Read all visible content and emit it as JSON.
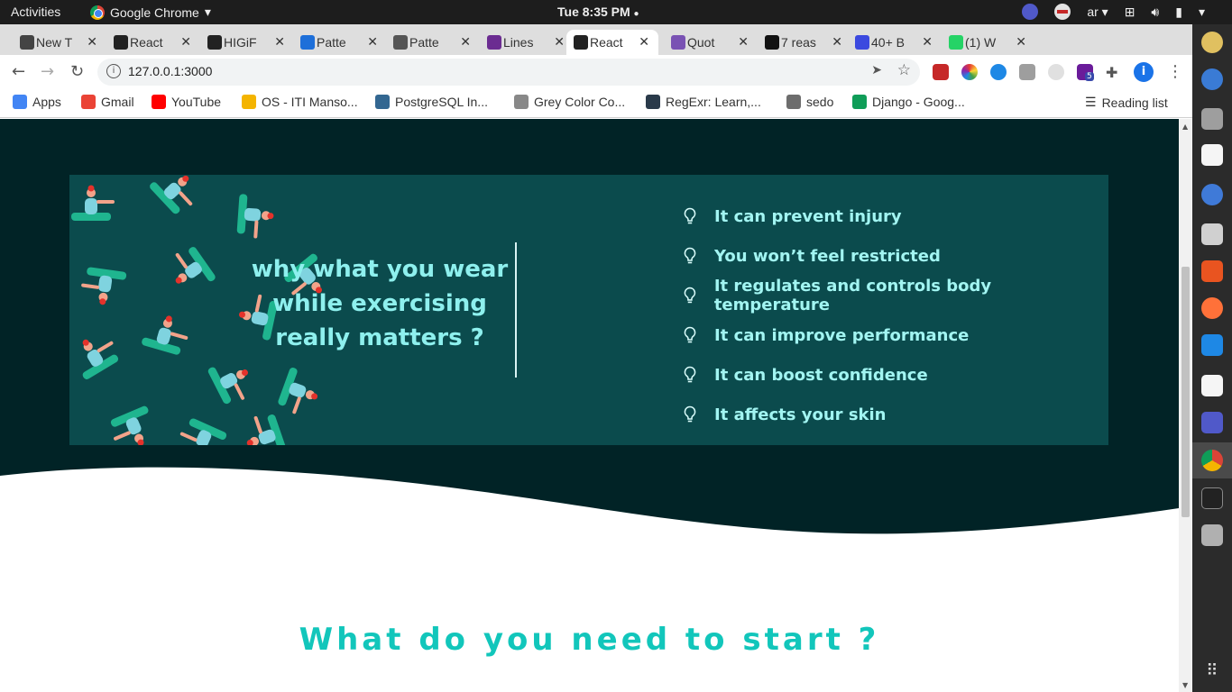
{
  "system_bar": {
    "activities": "Activities",
    "app_name": "Google Chrome",
    "clock": "Tue  8:35 PM",
    "language": "ar"
  },
  "browser": {
    "tabs": [
      {
        "label": "New T",
        "favicon": "globe-icon",
        "color": "#444"
      },
      {
        "label": "React",
        "favicon": "react-icon",
        "color": "#222"
      },
      {
        "label": "HIGiF",
        "favicon": "github-icon",
        "color": "#222"
      },
      {
        "label": "Patte",
        "favicon": "e-icon",
        "color": "#1e6fd9"
      },
      {
        "label": "Patte",
        "favicon": "pattern-icon",
        "color": "#555"
      },
      {
        "label": "Lines",
        "favicon": "owl-icon",
        "color": "#6b2c91"
      },
      {
        "label": "React",
        "favicon": "react-icon",
        "color": "#222",
        "active": true
      },
      {
        "label": "Quot",
        "favicon": "bootstrap-icon",
        "color": "#7952b3"
      },
      {
        "label": "7 reas",
        "favicon": "b-icon",
        "color": "#111"
      },
      {
        "label": "40+ B",
        "favicon": "dev-icon",
        "color": "#3b49df"
      },
      {
        "label": "(1) W",
        "favicon": "whatsapp-icon",
        "color": "#25d366"
      }
    ],
    "url": "127.0.0.1:3000",
    "profile_initial": "i",
    "extension_badge": "5",
    "bookmarks": [
      {
        "label": "Apps",
        "icon": "apps-grid-icon",
        "color": "#4285f4"
      },
      {
        "label": "Gmail",
        "icon": "google-icon",
        "color": "#ea4335"
      },
      {
        "label": "YouTube",
        "icon": "youtube-icon",
        "color": "#ff0000"
      },
      {
        "label": "OS - ITI Manso...",
        "icon": "drive-icon",
        "color": "#f4b400"
      },
      {
        "label": "PostgreSQL In...",
        "icon": "postgres-icon",
        "color": "#336791"
      },
      {
        "label": "Grey Color Co...",
        "icon": "palette-icon",
        "color": "#888"
      },
      {
        "label": "RegExr: Learn,...",
        "icon": "regexr-icon",
        "color": "#2a3a4a"
      },
      {
        "label": "sedo",
        "icon": "folder-icon",
        "color": "#6d6d6d"
      },
      {
        "label": "Django - Goog...",
        "icon": "drive-icon",
        "color": "#0f9d58"
      }
    ],
    "reading_list": "Reading list"
  },
  "page": {
    "colors": {
      "dark_bg": "#012326",
      "card_bg": "#0b4b4d",
      "title_text": "#8ef0ee",
      "reason_text": "#a2f5f2",
      "accent": "#12c6bb",
      "figure_skin": "#f2a38a",
      "figure_suit": "#1fb58f",
      "figure_top": "#7fd3df",
      "figure_hair": "#e4322b"
    },
    "card_title": "why what you wear while exercising really matters ?",
    "reasons": [
      "It can prevent injury",
      "You won’t feel restricted",
      "It regulates and controls body temperature",
      "It can improve performance",
      "It can boost confidence",
      "It affects your skin"
    ],
    "section_title": "What do you need to start ?"
  }
}
